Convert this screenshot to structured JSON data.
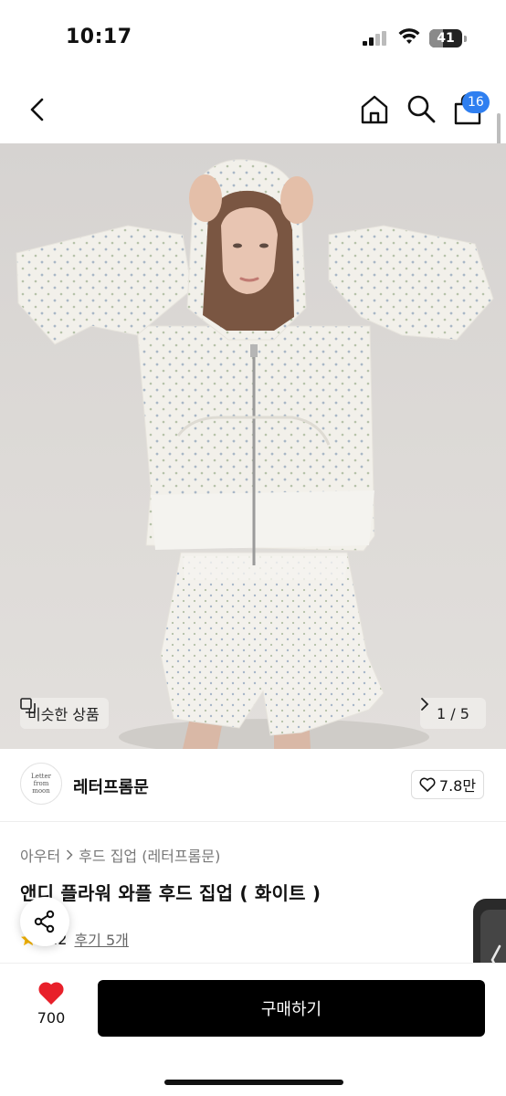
{
  "status_bar": {
    "time": "10:17",
    "battery": "41",
    "battery_level_percent": 41
  },
  "nav": {
    "cart_count": "16",
    "icons": [
      "chevron-left-icon",
      "home-icon",
      "search-icon",
      "shopping-bag-icon"
    ]
  },
  "gallery": {
    "similar_label": "비슷한 상품",
    "pager": "1 / 5"
  },
  "brand": {
    "logo_text": [
      "Letter",
      "from",
      "moon"
    ],
    "name": "레터프롬문",
    "likes": "7.8만"
  },
  "product": {
    "breadcrumb": [
      "아우터",
      "후드 집업 (레터프롬문)"
    ],
    "title": "앤디 플라워 와플 후드 집업 ( 화이트 )",
    "rating": "5.2",
    "reviews": "후기 5개"
  },
  "bottom": {
    "wish_count": "700",
    "buy_label": "구매하기"
  },
  "colors": {
    "badge": "#2f7ff0",
    "buy_button": "#000000",
    "heart": "#e8202a",
    "star": "#f5b400"
  }
}
